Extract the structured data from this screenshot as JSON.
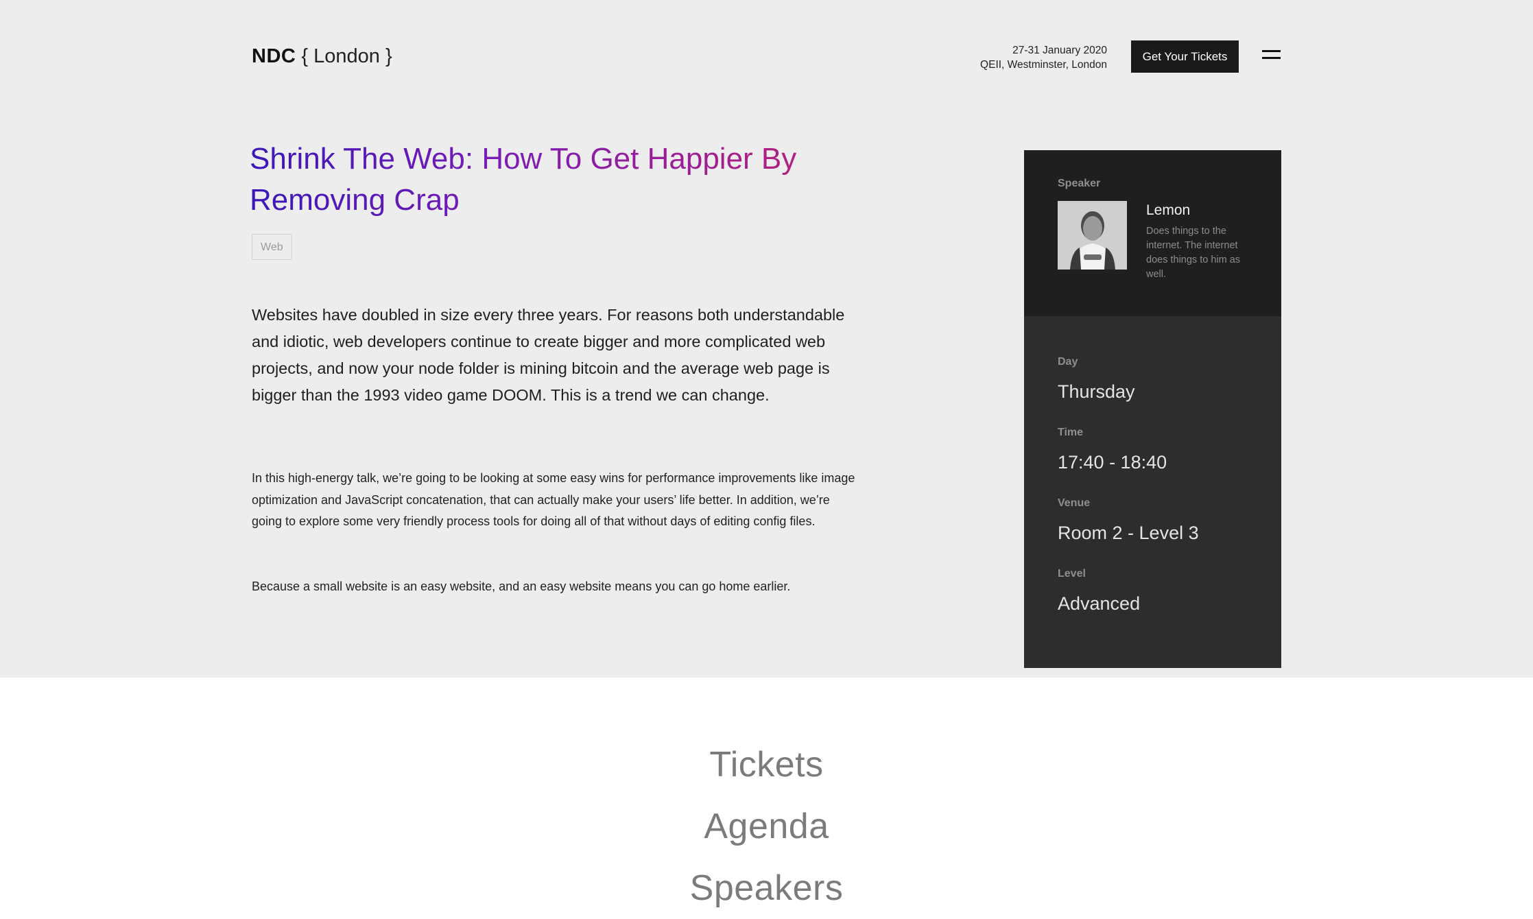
{
  "header": {
    "logo_brand": "NDC",
    "logo_city": "{ London }",
    "event_dates": "27-31 January 2020",
    "event_location": "QEII, Westminster, London",
    "tickets_button_label": "Get Your Tickets",
    "menu_icon": "hamburger-menu-icon"
  },
  "talk": {
    "title": "Shrink The Web: How To Get Happier By Removing Crap",
    "tag": "Web",
    "lead": "Websites have doubled in size every three years. For reasons both understandable and idiotic, web developers continue to create bigger and more complicated web projects, and now your node folder is mining bitcoin and the average web page is bigger than the 1993 video game DOOM. This is a trend we can change.",
    "paragraph1": "In this high-energy talk, we’re going to be looking at some easy wins for performance improvements like image optimization and JavaScript concatenation, that can actually make your users’ life better. In addition, we’re going to explore some very friendly process tools for doing all of that without days of editing config files.",
    "paragraph2": "Because a small website is an easy website, and an easy website means you can go home earlier."
  },
  "sidebar": {
    "speaker_label": "Speaker",
    "speaker_name": "Lemon",
    "speaker_bio": "Does things to the internet. The internet does things to him as well.",
    "day_label": "Day",
    "day_value": "Thursday",
    "time_label": "Time",
    "time_value": "17:40 - 18:40",
    "venue_label": "Venue",
    "venue_value": "Room 2 - Level 3",
    "level_label": "Level",
    "level_value": "Advanced"
  },
  "nav": {
    "items": [
      {
        "label": "Tickets"
      },
      {
        "label": "Agenda"
      },
      {
        "label": "Speakers"
      }
    ]
  },
  "colors": {
    "page_background": "#ededed",
    "title_gradient_start": "#3a17b8",
    "title_gradient_end": "#b1207f",
    "sidebar_dark": "#1f1f1f",
    "sidebar_body": "#2d2d2d",
    "button_background": "#1a1a1a"
  }
}
